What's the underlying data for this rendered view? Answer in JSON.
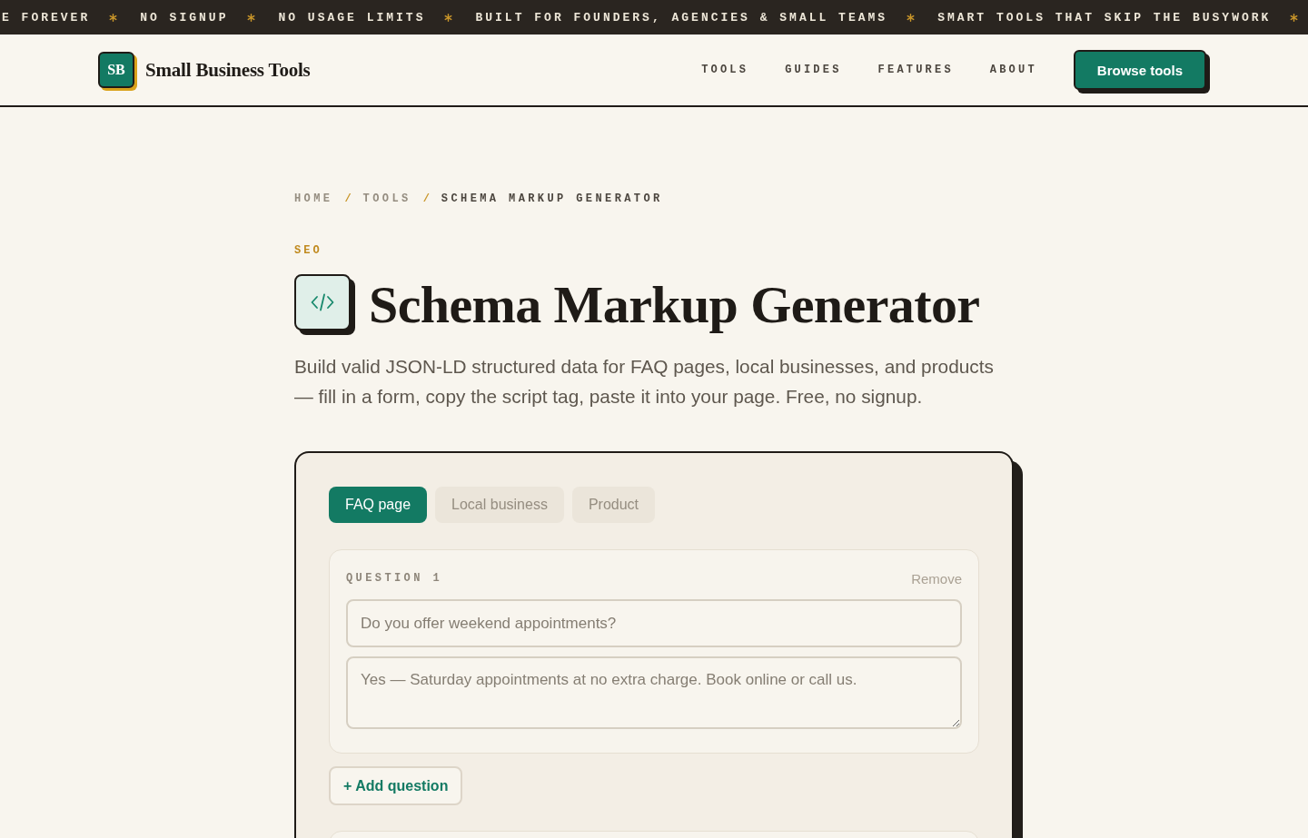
{
  "ticker": {
    "items": [
      "E FOREVER",
      "NO SIGNUP",
      "NO USAGE LIMITS",
      "BUILT FOR FOUNDERS, AGENCIES & SMALL TEAMS",
      "SMART TOOLS THAT SKIP THE BUSYWORK"
    ]
  },
  "header": {
    "logo": {
      "mark": "SB",
      "name": "Small Business Tools"
    },
    "nav": [
      {
        "label": "TOOLS"
      },
      {
        "label": "GUIDES"
      },
      {
        "label": "FEATURES"
      },
      {
        "label": "ABOUT"
      }
    ],
    "cta": "Browse tools"
  },
  "breadcrumb": [
    {
      "kind": "link",
      "label": "HOME"
    },
    {
      "kind": "separator",
      "label": "/"
    },
    {
      "kind": "link",
      "label": "TOOLS"
    },
    {
      "kind": "separator",
      "label": "/"
    },
    {
      "kind": "current",
      "label": "SCHEMA MARKUP GENERATOR"
    }
  ],
  "category": "SEO",
  "title": "Schema Markup Generator",
  "description": "Build valid JSON-LD structured data for FAQ pages, local businesses, and products — fill in a form, copy the script tag, paste it into your page. Free, no signup.",
  "generator": {
    "tabs": [
      {
        "label": "FAQ page",
        "selected": true
      },
      {
        "label": "Local business",
        "selected": false
      },
      {
        "label": "Product",
        "selected": false
      }
    ],
    "questions": [
      {
        "label": "QUESTION 1",
        "remove": {
          "label": "Remove",
          "disabled": true
        },
        "question_placeholder": "Do you offer weekend appointments?",
        "answer_placeholder": "Yes — Saturday appointments at no extra charge. Book online or call us."
      }
    ],
    "add_button": "+ Add question"
  }
}
